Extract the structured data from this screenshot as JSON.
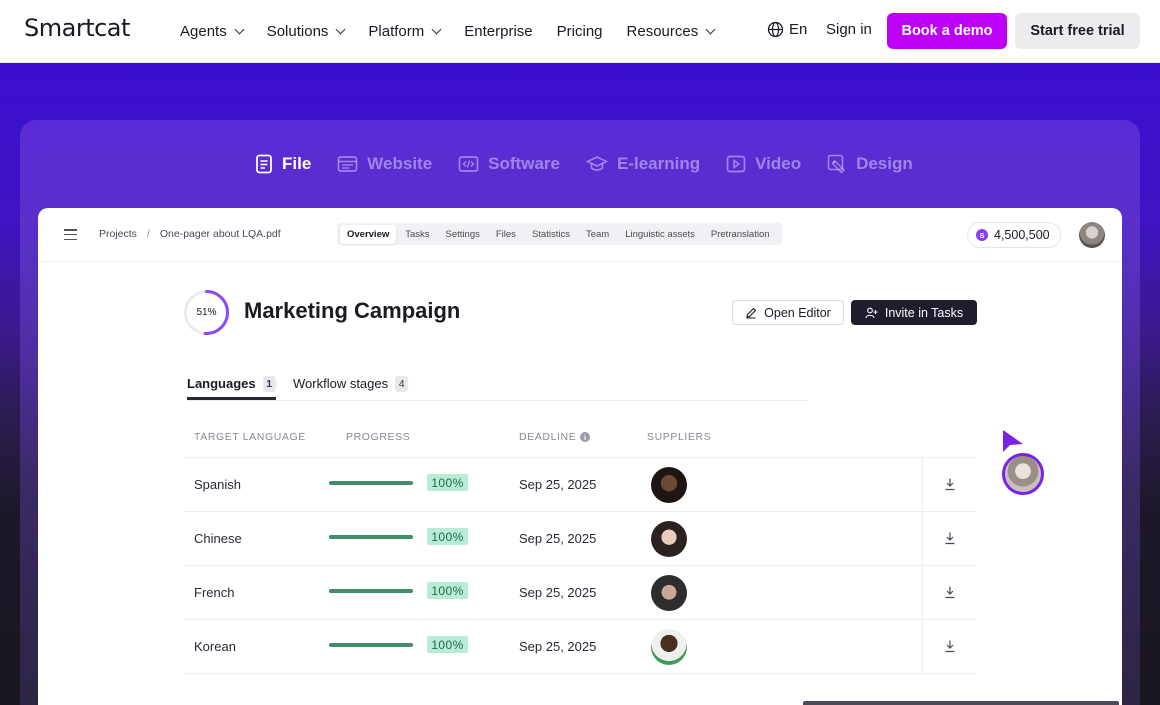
{
  "nav": {
    "logo": "Smartcat",
    "items": [
      {
        "label": "Agents",
        "dropdown": true
      },
      {
        "label": "Solutions",
        "dropdown": true
      },
      {
        "label": "Platform",
        "dropdown": true
      },
      {
        "label": "Enterprise",
        "dropdown": false
      },
      {
        "label": "Pricing",
        "dropdown": false
      },
      {
        "label": "Resources",
        "dropdown": true
      }
    ],
    "language": "En",
    "sign_in": "Sign in",
    "book_demo": "Book a demo",
    "start_trial": "Start free trial",
    "accent_color": "#bd00f6"
  },
  "categories": [
    {
      "label": "File",
      "icon": "document-icon",
      "active": true
    },
    {
      "label": "Website",
      "icon": "browser-window-icon",
      "active": false
    },
    {
      "label": "Software",
      "icon": "code-icon",
      "active": false
    },
    {
      "label": "E-learning",
      "icon": "graduation-cap-icon",
      "active": false
    },
    {
      "label": "Video",
      "icon": "play-icon",
      "active": false
    },
    {
      "label": "Design",
      "icon": "design-pen-icon",
      "active": false
    }
  ],
  "app": {
    "breadcrumb": {
      "root": "Projects",
      "separator": "/",
      "current": "One-pager about LQA.pdf"
    },
    "subtabs": [
      "Overview",
      "Tasks",
      "Settings",
      "Files",
      "Statistics",
      "Team",
      "Linguistic assets",
      "Pretranslation"
    ],
    "active_subtab": "Overview",
    "credits": {
      "coin": "S",
      "amount": "4,500,500"
    },
    "project": {
      "progress_label": "51%",
      "progress_fraction": 0.51,
      "title": "Marketing Campaign",
      "open_editor": "Open Editor",
      "invite": "Invite in Tasks"
    },
    "tabs": [
      {
        "label": "Languages",
        "count": "1",
        "active": true
      },
      {
        "label": "Workflow stages",
        "count": "4",
        "active": false
      }
    ],
    "columns": {
      "target_language": "TARGET LANGUAGE",
      "progress": "PROGRESS",
      "deadline": "DEADLINE",
      "deadline_info": "i",
      "suppliers": "SUPPLIERS"
    },
    "rows": [
      {
        "language": "Spanish",
        "progress": "100%",
        "progress_fraction": 1.0,
        "deadline": "Sep 25, 2025"
      },
      {
        "language": "Chinese",
        "progress": "100%",
        "progress_fraction": 1.0,
        "deadline": "Sep 25, 2025"
      },
      {
        "language": "French",
        "progress": "100%",
        "progress_fraction": 1.0,
        "deadline": "Sep 25, 2025"
      },
      {
        "language": "Korean",
        "progress": "100%",
        "progress_fraction": 1.0,
        "deadline": "Sep 25, 2025"
      }
    ],
    "progress_color": "#3f8d69"
  }
}
